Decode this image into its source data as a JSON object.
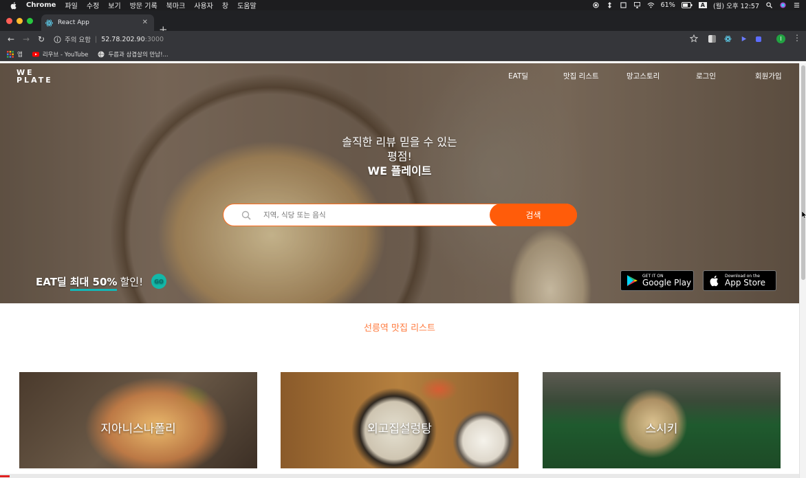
{
  "os": {
    "menu": [
      "Chrome",
      "파일",
      "수정",
      "보기",
      "방문 기록",
      "북마크",
      "사용자",
      "창",
      "도움말"
    ],
    "battery": "61%",
    "input_source": "A",
    "clock": "(월) 오후 12:57"
  },
  "browser": {
    "tab_title": "React App",
    "security_label": "주의 요함",
    "url_host": "52.78.202.90",
    "url_port": ":3000",
    "bookmarks": [
      "앱",
      "리우브 - YouTube",
      "두릅과 삼겹살의 만남!..."
    ]
  },
  "site": {
    "logo_line1": "WE",
    "logo_line2": "PLATE",
    "nav": [
      "EAT딜",
      "맛집 리스트",
      "망고스토리",
      "로그인",
      "회원가입"
    ],
    "headline": [
      "솔직한 리뷰 믿을 수 있는",
      "평점!",
      "WE 플레이트"
    ],
    "search_placeholder": "지역, 식당 또는 음식",
    "search_button": "검색",
    "promo_prefix": "EAT딜",
    "promo_highlight": "최대 50%",
    "promo_suffix": "할인!",
    "promo_go": "GO",
    "google_play_small": "GET IT ON",
    "google_play_big": "Google Play",
    "app_store_small": "Download on the",
    "app_store_big": "App Store",
    "list_title": "선릉역 맛집 리스트",
    "restaurants": [
      "지아니스나폴리",
      "외고집설렁탕",
      "스시키"
    ]
  },
  "colors": {
    "accent": "#ff5c0a",
    "teal": "#13b8b8"
  }
}
